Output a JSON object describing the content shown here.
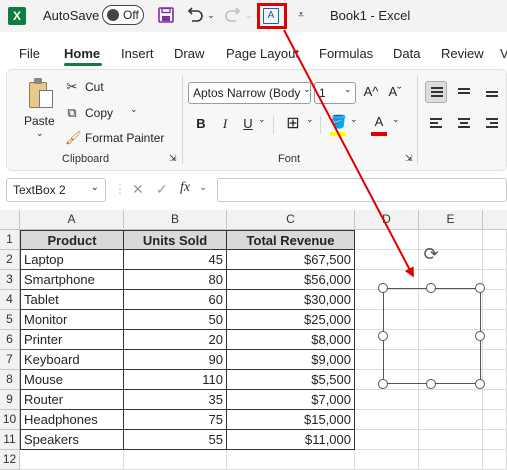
{
  "titlebar": {
    "app_logo": "X",
    "autosave_label": "AutoSave",
    "autosave_state": "Off",
    "title": "Book1  -  Excel",
    "icons": [
      "save-icon",
      "undo-icon",
      "redo-icon",
      "text-box-icon",
      "customize-qat-icon"
    ]
  },
  "tabs": [
    "File",
    "Home",
    "Insert",
    "Draw",
    "Page Layout",
    "Formulas",
    "Data",
    "Review",
    "V"
  ],
  "active_tab": "Home",
  "clipboard": {
    "paste_label": "Paste",
    "cut_label": "Cut",
    "copy_label": "Copy",
    "format_painter_label": "Format Painter",
    "group_label": "Clipboard"
  },
  "font": {
    "font_name": "Aptos Narrow (Body",
    "font_size": "1",
    "bold": "B",
    "italic": "I",
    "underline": "U",
    "font_color_glyph": "A",
    "grow_font": "A^",
    "shrink_font": "Aˇ",
    "group_label": "Font",
    "fill_color": "#ffff00",
    "font_color": "#e00000"
  },
  "formula_bar": {
    "name_box": "TextBox 2",
    "fx": "fx",
    "cancel": "✕",
    "enter": "✓",
    "formula": ""
  },
  "columns": [
    "A",
    "B",
    "C",
    "D",
    "E"
  ],
  "rows": [
    "1",
    "2",
    "3",
    "4",
    "5",
    "6",
    "7",
    "8",
    "9",
    "10",
    "11",
    "12"
  ],
  "table": {
    "headers": [
      "Product",
      "Units Sold",
      "Total Revenue"
    ],
    "data": [
      [
        "Laptop",
        "45",
        "$67,500"
      ],
      [
        "Smartphone",
        "80",
        "$56,000"
      ],
      [
        "Tablet",
        "60",
        "$30,000"
      ],
      [
        "Monitor",
        "50",
        "$25,000"
      ],
      [
        "Printer",
        "20",
        "$8,000"
      ],
      [
        "Keyboard",
        "90",
        "$9,000"
      ],
      [
        "Mouse",
        "110",
        "$5,500"
      ],
      [
        "Router",
        "35",
        "$7,000"
      ],
      [
        "Headphones",
        "75",
        "$15,000"
      ],
      [
        "Speakers",
        "55",
        "$11,000"
      ]
    ]
  },
  "annotation_color": "#e00000"
}
